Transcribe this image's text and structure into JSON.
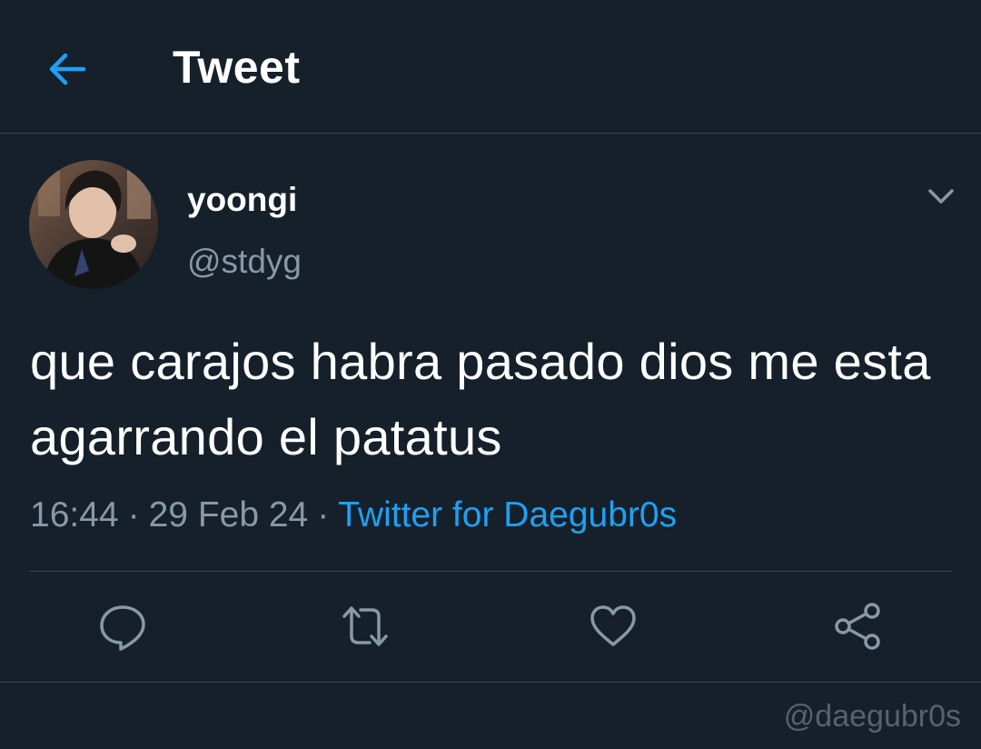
{
  "header": {
    "back_icon": "arrow-left-icon",
    "title": "Tweet"
  },
  "tweet": {
    "author": {
      "display_name": "yoongi",
      "handle": "@stdyg"
    },
    "text": "que carajos habra pasado dios me esta agarrando el patatus",
    "time": "16:44",
    "date": "29 Feb 24",
    "separator": "·",
    "source": "Twitter for Daegubr0s"
  },
  "actions": [
    {
      "icon": "reply-icon"
    },
    {
      "icon": "retweet-icon"
    },
    {
      "icon": "like-icon"
    },
    {
      "icon": "share-icon"
    }
  ],
  "watermark": "@daegubr0s",
  "colors": {
    "background": "#15202b",
    "accent": "#1da1f2",
    "secondary_text": "#8899a6",
    "border": "#38444d"
  }
}
